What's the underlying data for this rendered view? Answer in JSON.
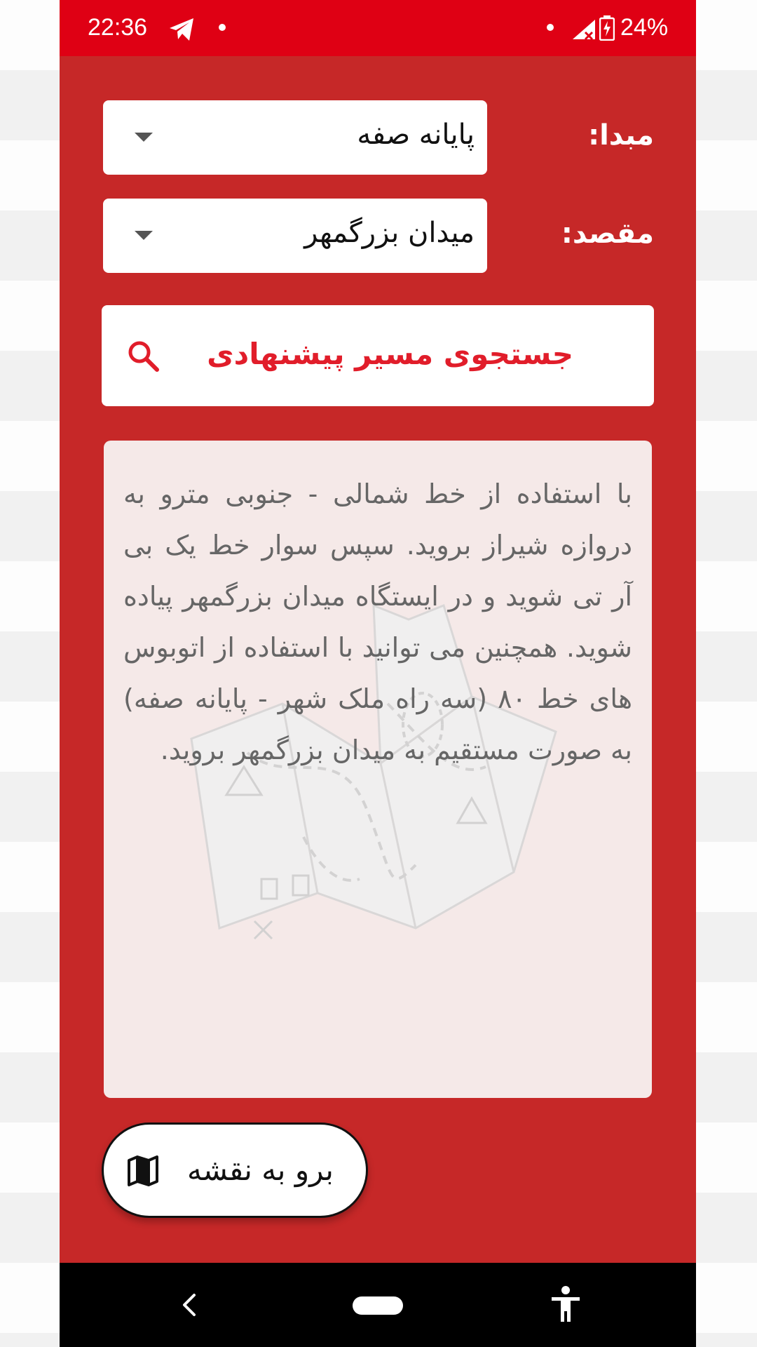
{
  "status_bar": {
    "time": "22:36",
    "battery": "24%"
  },
  "form": {
    "origin_label": "مبدا:",
    "origin_value": "پایانه صفه",
    "destination_label": "مقصد:",
    "destination_value": "میدان بزرگمهر"
  },
  "search": {
    "label": "جستجوی مسیر پیشنهادی"
  },
  "route": {
    "text": "با استفاده از خط شمالی - جنوبی مترو به دروازه شیراز بروید. سپس سوار خط یک بی آر تی شوید و در ایستگاه میدان بزرگمهر پیاده شوید. همچنین می توانید با استفاده از اتوبوس های خط ۸۰ (سه راه ملک شهر - پایانه صفه) به صورت مستقیم به میدان بزرگمهر بروید."
  },
  "map_button": {
    "label": "برو به نقشه"
  },
  "colors": {
    "status_bar": "#df0014",
    "background": "#c62828",
    "accent_text": "#e11d2a",
    "panel": "#f5e9e8"
  },
  "icons": {
    "status": [
      "telegram-icon",
      "signal-icon",
      "battery-charging-icon"
    ],
    "search": "search-icon",
    "map": "map-icon",
    "nav": [
      "back-icon",
      "home-pill",
      "accessibility-icon"
    ]
  }
}
